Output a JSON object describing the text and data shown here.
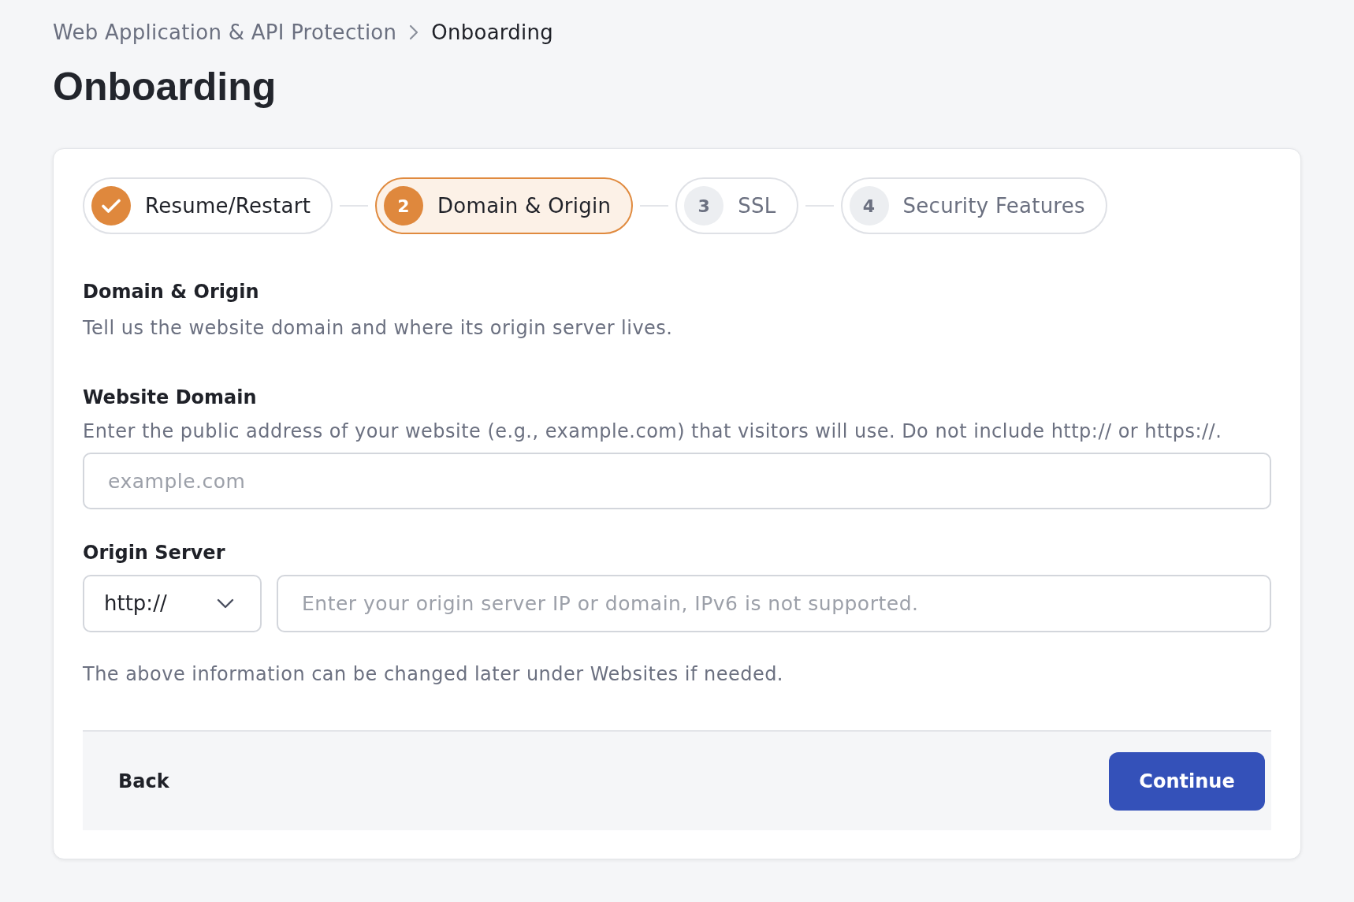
{
  "breadcrumb": [
    {
      "label": "Web Application & API Protection",
      "current": false
    },
    {
      "label": "Onboarding",
      "current": true
    }
  ],
  "page_title": "Onboarding",
  "steps": [
    {
      "label": "Resume/Restart",
      "completed": true,
      "selected": false
    },
    {
      "number": "2",
      "label": "Domain & Origin",
      "completed": false,
      "selected": true
    },
    {
      "number": "3",
      "label": "SSL",
      "completed": false,
      "selected": false
    },
    {
      "number": "4",
      "label": "Security Features",
      "completed": false,
      "selected": false
    }
  ],
  "section": {
    "title": "Domain & Origin",
    "description": "Tell us the website domain and where its origin server lives."
  },
  "website_domain": {
    "label": "Website Domain",
    "help": "Enter the public address of your website (e.g., example.com) that visitors will use. Do not include http:// or https://.",
    "placeholder": "example.com"
  },
  "origin_server": {
    "label": "Origin Server",
    "protocol": "http://",
    "placeholder": "Enter your origin server IP or domain, IPv6 is not supported."
  },
  "note": "The above information can be changed later under Websites if needed.",
  "footer": {
    "back": "Back",
    "continue": "Continue"
  }
}
